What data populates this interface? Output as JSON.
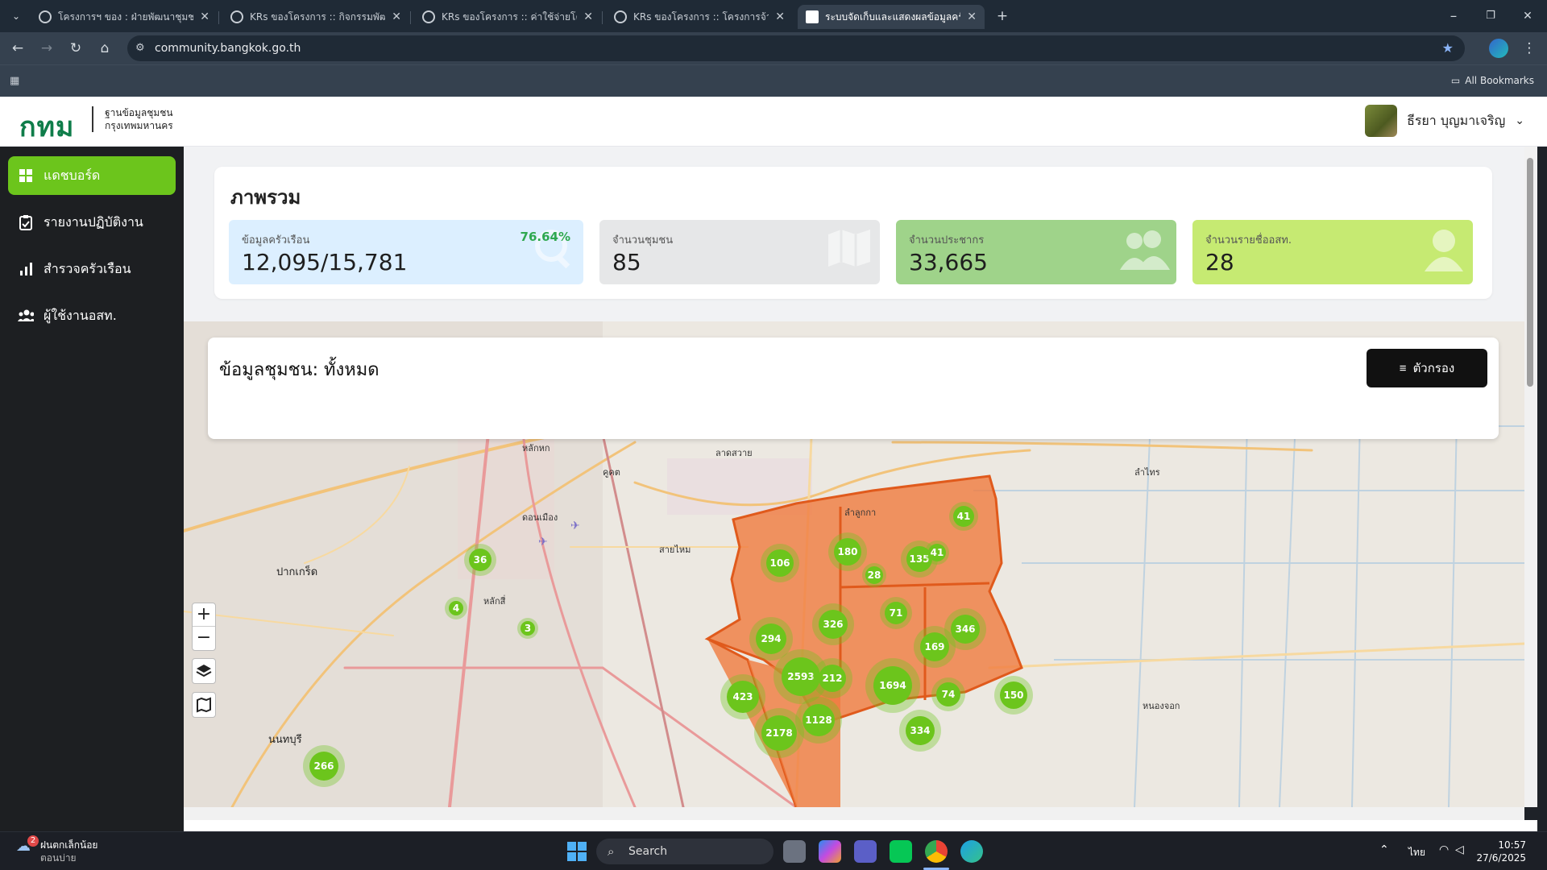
{
  "browser": {
    "tabs": [
      {
        "title": "โครงการฯ ของ : ฝ่ายพัฒนาชุมชนแล"
      },
      {
        "title": "KRs ของโครงการ :: กิจกรรมพัฒนาฐ"
      },
      {
        "title": "KRs ของโครงการ :: ค่าใช้จ่ายโครงการ"
      },
      {
        "title": "KRs ของโครงการ :: โครงการจ้างอาส"
      },
      {
        "title": "ระบบจัดเก็บและแสดงผลข้อมูลครัวเรือ"
      }
    ],
    "url": "community.bangkok.go.th",
    "all_bookmarks": "All Bookmarks"
  },
  "header": {
    "logo": "กทม",
    "logo_line1": "ฐานข้อมูลชุมชน",
    "logo_line2": "กรุงเทพมหานคร",
    "user_name": "ธีรยา บุญมาเจริญ"
  },
  "sidebar": {
    "items": [
      {
        "label": "แดชบอร์ด",
        "icon": "dashboard-icon",
        "active": true
      },
      {
        "label": "รายงานปฏิบัติงาน",
        "icon": "clipboard-icon",
        "active": false
      },
      {
        "label": "สำรวจครัวเรือน",
        "icon": "bar-chart-icon",
        "active": false
      },
      {
        "label": "ผู้ใช้งานอสท.",
        "icon": "users-icon",
        "active": false
      }
    ]
  },
  "overview": {
    "title": "ภาพรวม",
    "cards": [
      {
        "label": "ข้อมูลครัวเรือน",
        "value": "12,095/15,781",
        "percent": "76.64%",
        "color": "#dcefff",
        "icon": "search-icon"
      },
      {
        "label": "จำนวนชุมชน",
        "value": "85",
        "color": "#e6e7e8",
        "icon": "map-icon"
      },
      {
        "label": "จำนวนประชากร",
        "value": "33,665",
        "color": "#9fd38a",
        "icon": "people-icon"
      },
      {
        "label": "จำนวนรายชื่ออสท.",
        "value": "28",
        "color": "#c6ea72",
        "icon": "person-icon"
      }
    ]
  },
  "map": {
    "panel_title": "ข้อมูลชุมชน: ทั้งหมด",
    "filter_label": "ตัวกรอง",
    "zoom_in": "+",
    "zoom_out": "−",
    "place_labels": [
      "หลักหก",
      "คูคต",
      "ลาดสวาย",
      "ลำลูกกา",
      "ลำไทร",
      "ปากเกร็ด",
      "นนทบุรี",
      "หลักสี่",
      "สายไหม",
      "ดอนเมือง",
      "หนองจอก"
    ],
    "clusters": [
      {
        "count": "36"
      },
      {
        "count": "4"
      },
      {
        "count": "3"
      },
      {
        "count": "266"
      },
      {
        "count": "106"
      },
      {
        "count": "180"
      },
      {
        "count": "28"
      },
      {
        "count": "135"
      },
      {
        "count": "41"
      },
      {
        "count": "41"
      },
      {
        "count": "71"
      },
      {
        "count": "326"
      },
      {
        "count": "346"
      },
      {
        "count": "294"
      },
      {
        "count": "169"
      },
      {
        "count": "2593"
      },
      {
        "count": "212"
      },
      {
        "count": "1694"
      },
      {
        "count": "423"
      },
      {
        "count": "74"
      },
      {
        "count": "150"
      },
      {
        "count": "1128"
      },
      {
        "count": "2178"
      },
      {
        "count": "334"
      }
    ]
  },
  "taskbar": {
    "weather_title": "ฝนตกเล็กน้อย",
    "weather_sub": "ตอนบ่าย",
    "weather_badge": "2",
    "search": "Search",
    "lang": "ไทย",
    "time": "10:57",
    "date": "27/6/2025"
  }
}
